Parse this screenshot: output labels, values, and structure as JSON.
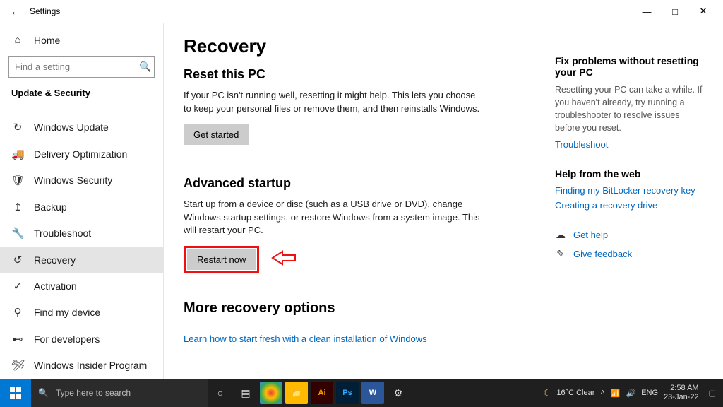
{
  "window": {
    "title": "Settings"
  },
  "sidebar": {
    "home_label": "Home",
    "search_placeholder": "Find a setting",
    "breadcrumb": "Update & Security",
    "items": [
      {
        "label": "Windows Update"
      },
      {
        "label": "Delivery Optimization"
      },
      {
        "label": "Windows Security"
      },
      {
        "label": "Backup"
      },
      {
        "label": "Troubleshoot"
      },
      {
        "label": "Recovery"
      },
      {
        "label": "Activation"
      },
      {
        "label": "Find my device"
      },
      {
        "label": "For developers"
      },
      {
        "label": "Windows Insider Program"
      }
    ]
  },
  "page": {
    "title": "Recovery",
    "reset": {
      "heading": "Reset this PC",
      "desc": "If your PC isn't running well, resetting it might help. This lets you choose to keep your personal files or remove them, and then reinstalls Windows.",
      "button": "Get started"
    },
    "advanced": {
      "heading": "Advanced startup",
      "desc": "Start up from a device or disc (such as a USB drive or DVD), change Windows startup settings, or restore Windows from a system image. This will restart your PC.",
      "button": "Restart now"
    },
    "more": {
      "heading": "More recovery options",
      "link": "Learn how to start fresh with a clean installation of Windows"
    }
  },
  "aside": {
    "fix": {
      "heading": "Fix problems without resetting your PC",
      "desc": "Resetting your PC can take a while. If you haven't already, try running a troubleshooter to resolve issues before you reset.",
      "link": "Troubleshoot"
    },
    "web": {
      "heading": "Help from the web",
      "link1": "Finding my BitLocker recovery key",
      "link2": "Creating a recovery drive"
    },
    "help_label": "Get help",
    "feedback_label": "Give feedback"
  },
  "taskbar": {
    "search_placeholder": "Type here to search",
    "weather": "16°C  Clear",
    "lang": "ENG",
    "time": "2:58 AM",
    "date": "23-Jan-22"
  }
}
